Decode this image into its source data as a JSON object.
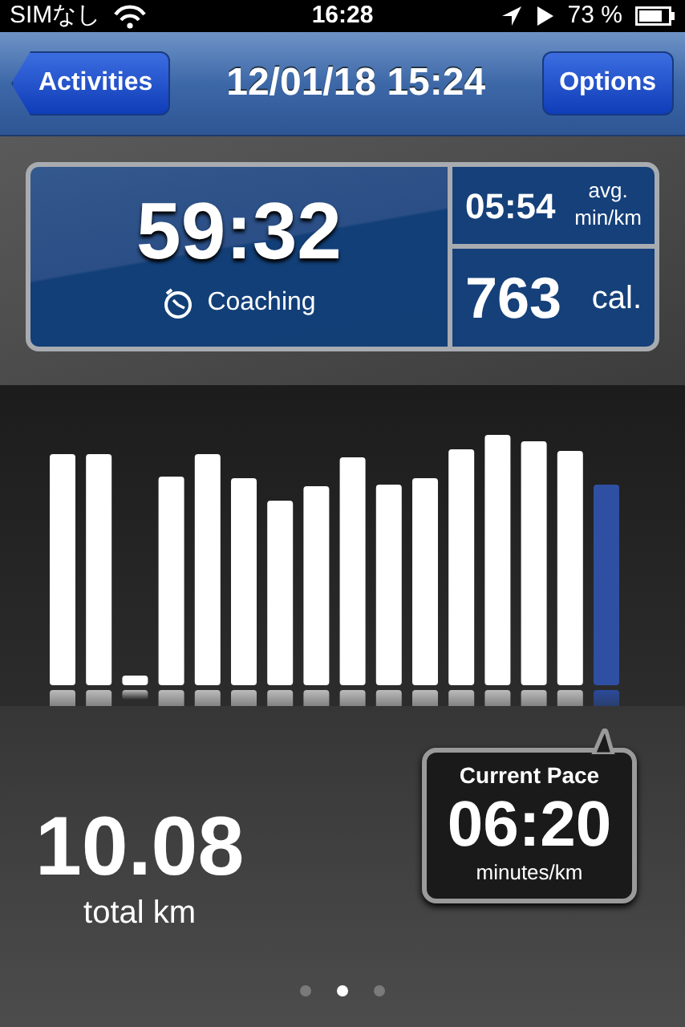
{
  "status_bar": {
    "carrier": "SIMなし",
    "time": "16:28",
    "battery": "73 %"
  },
  "nav_bar": {
    "back_button": "Activities",
    "title": "12/01/18 15:24",
    "right_button": "Options"
  },
  "summary": {
    "duration": "59:32",
    "coaching": "Coaching",
    "avg_pace": "05:54",
    "avg_pace_unit_1": "avg.",
    "avg_pace_unit_2": "min/km",
    "calories": "763",
    "calories_unit": "cal."
  },
  "distance": {
    "value": "10.08",
    "label": "total km"
  },
  "current_pace": {
    "title": "Current Pace",
    "value": "06:20",
    "unit": "minutes/km"
  },
  "page_dots": [
    {
      "selected": false
    },
    {
      "selected": true
    },
    {
      "selected": false
    }
  ]
}
